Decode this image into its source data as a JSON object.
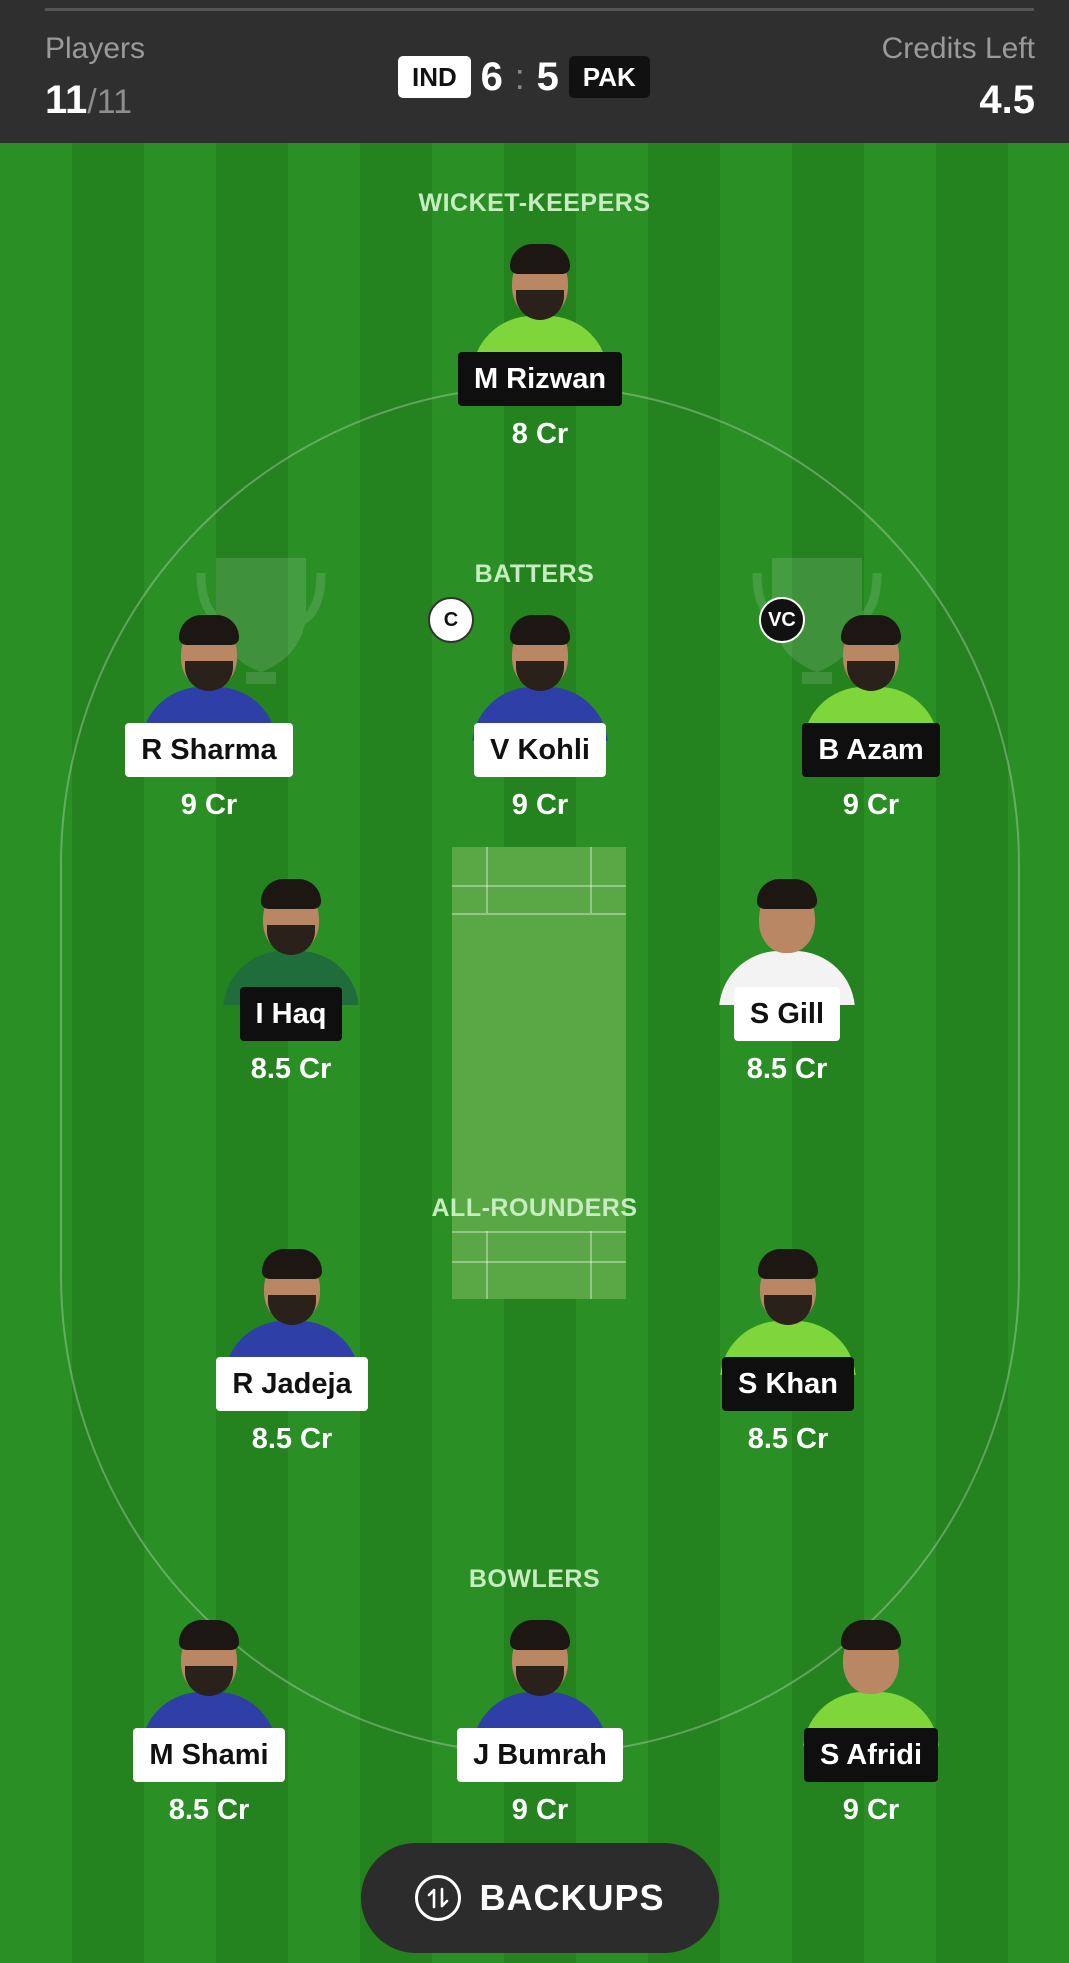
{
  "header": {
    "players_label": "Players",
    "players_selected": "11",
    "players_max": "/11",
    "credits_label": "Credits Left",
    "credits_value": "4.5",
    "team_a": "IND",
    "team_a_count": "6",
    "separator": ":",
    "team_b_count": "5",
    "team_b": "PAK"
  },
  "sections": {
    "wicket_keepers": "WICKET-KEEPERS",
    "batters": "BATTERS",
    "all_rounders": "ALL-ROUNDERS",
    "bowlers": "BOWLERS"
  },
  "players": {
    "rizwan": {
      "name": "M Rizwan",
      "credits": "8 Cr",
      "team": "PAK"
    },
    "sharma": {
      "name": "R Sharma",
      "credits": "9 Cr",
      "team": "IND"
    },
    "kohli": {
      "name": "V Kohli",
      "credits": "9 Cr",
      "team": "IND",
      "role": "C"
    },
    "azam": {
      "name": "B Azam",
      "credits": "9 Cr",
      "team": "PAK",
      "role": "VC"
    },
    "haq": {
      "name": "I Haq",
      "credits": "8.5 Cr",
      "team": "PAK"
    },
    "gill": {
      "name": "S Gill",
      "credits": "8.5 Cr",
      "team": "IND"
    },
    "jadeja": {
      "name": "R Jadeja",
      "credits": "8.5 Cr",
      "team": "IND"
    },
    "khan": {
      "name": "S Khan",
      "credits": "8.5 Cr",
      "team": "PAK"
    },
    "shami": {
      "name": "M Shami",
      "credits": "8.5 Cr",
      "team": "IND"
    },
    "bumrah": {
      "name": "J Bumrah",
      "credits": "9 Cr",
      "team": "IND"
    },
    "afridi": {
      "name": "S Afridi",
      "credits": "9 Cr",
      "team": "PAK"
    }
  },
  "backups": {
    "label": "BACKUPS",
    "icon": "swap-icon"
  },
  "colors": {
    "field_green": "#2a8f25",
    "pitch_green": "#5aa845",
    "header_bg": "#2f2f2f",
    "ind_tag": "#ffffff",
    "pak_tag": "#0f0f0f"
  }
}
